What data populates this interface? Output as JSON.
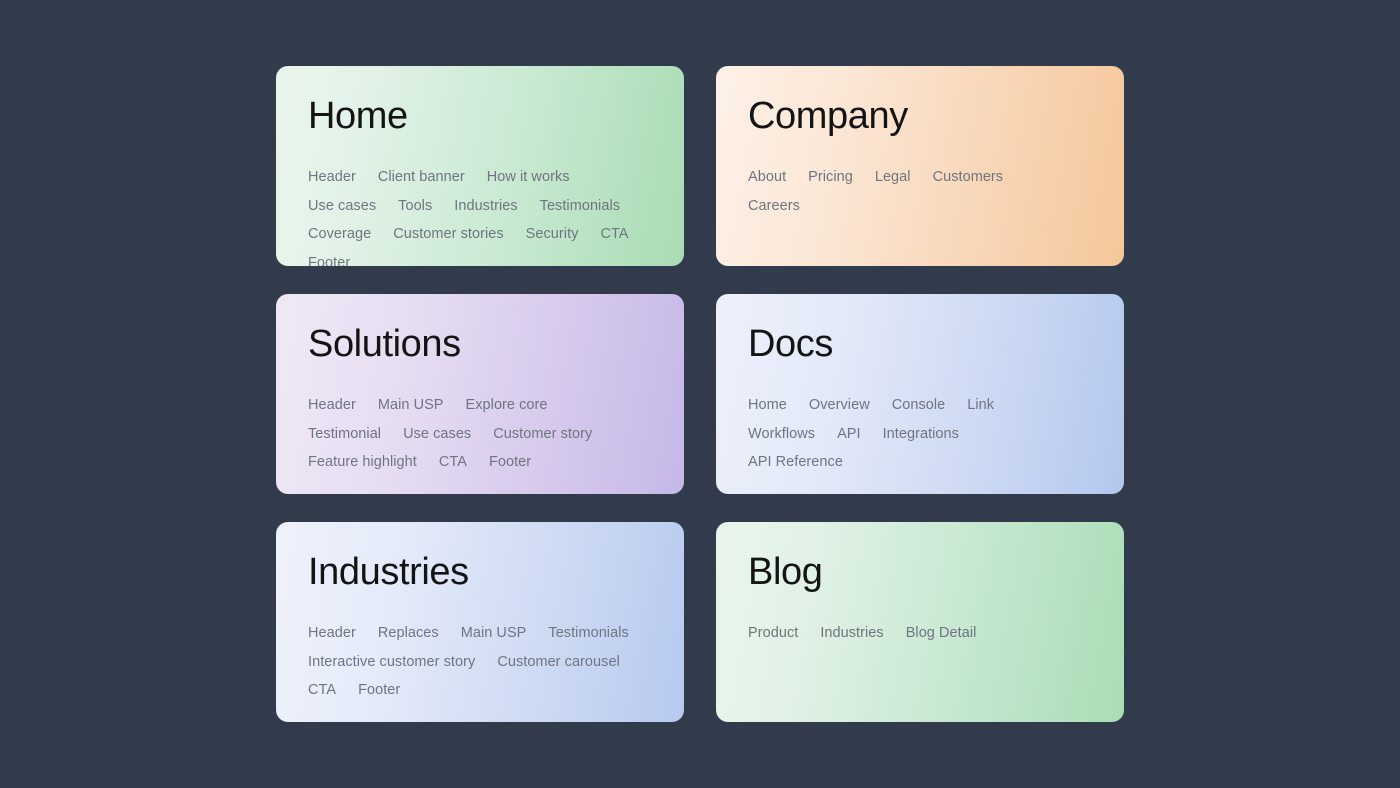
{
  "page": {
    "background_color": "#313b4c",
    "title_color": "#141414",
    "link_color": "#6f7580"
  },
  "cards": [
    {
      "id": "home",
      "title": "Home",
      "gradient_from": "#e9f5ec",
      "gradient_to": "#a8dcb4",
      "links": [
        "Header",
        "Client banner",
        "How it works",
        "Use cases",
        "Tools",
        "Industries",
        "Testimonials",
        "Coverage",
        "Customer stories",
        "Security",
        "CTA",
        "Footer"
      ]
    },
    {
      "id": "company",
      "title": "Company",
      "gradient_from": "#fdf1e7",
      "gradient_to": "#f5c79b",
      "links": [
        "About",
        "Pricing",
        "Legal",
        "Customers",
        "Careers"
      ]
    },
    {
      "id": "solutions",
      "title": "Solutions",
      "gradient_from": "#efe9f6",
      "gradient_to": "#c5b8e8",
      "links": [
        "Header",
        "Main USP",
        "Explore core",
        "Testimonial",
        "Use cases",
        "Customer story",
        "Feature highlight",
        "CTA",
        "Footer"
      ]
    },
    {
      "id": "docs",
      "title": "Docs",
      "gradient_from": "#eef1fb",
      "gradient_to": "#b3c7ee",
      "links": [
        "Home",
        "Overview",
        "Console",
        "Link",
        "Workflows",
        "API",
        "Integrations",
        "API Reference"
      ]
    },
    {
      "id": "industries",
      "title": "Industries",
      "gradient_from": "#eff2fc",
      "gradient_to": "#b6c9ef",
      "links": [
        "Header",
        "Replaces",
        "Main USP",
        "Testimonials",
        "Interactive customer story",
        "Customer carousel",
        "CTA",
        "Footer"
      ]
    },
    {
      "id": "blog",
      "title": "Blog",
      "gradient_from": "#e9f5ec",
      "gradient_to": "#a9ddb6",
      "links": [
        "Product",
        "Industries",
        "Blog Detail"
      ]
    }
  ]
}
